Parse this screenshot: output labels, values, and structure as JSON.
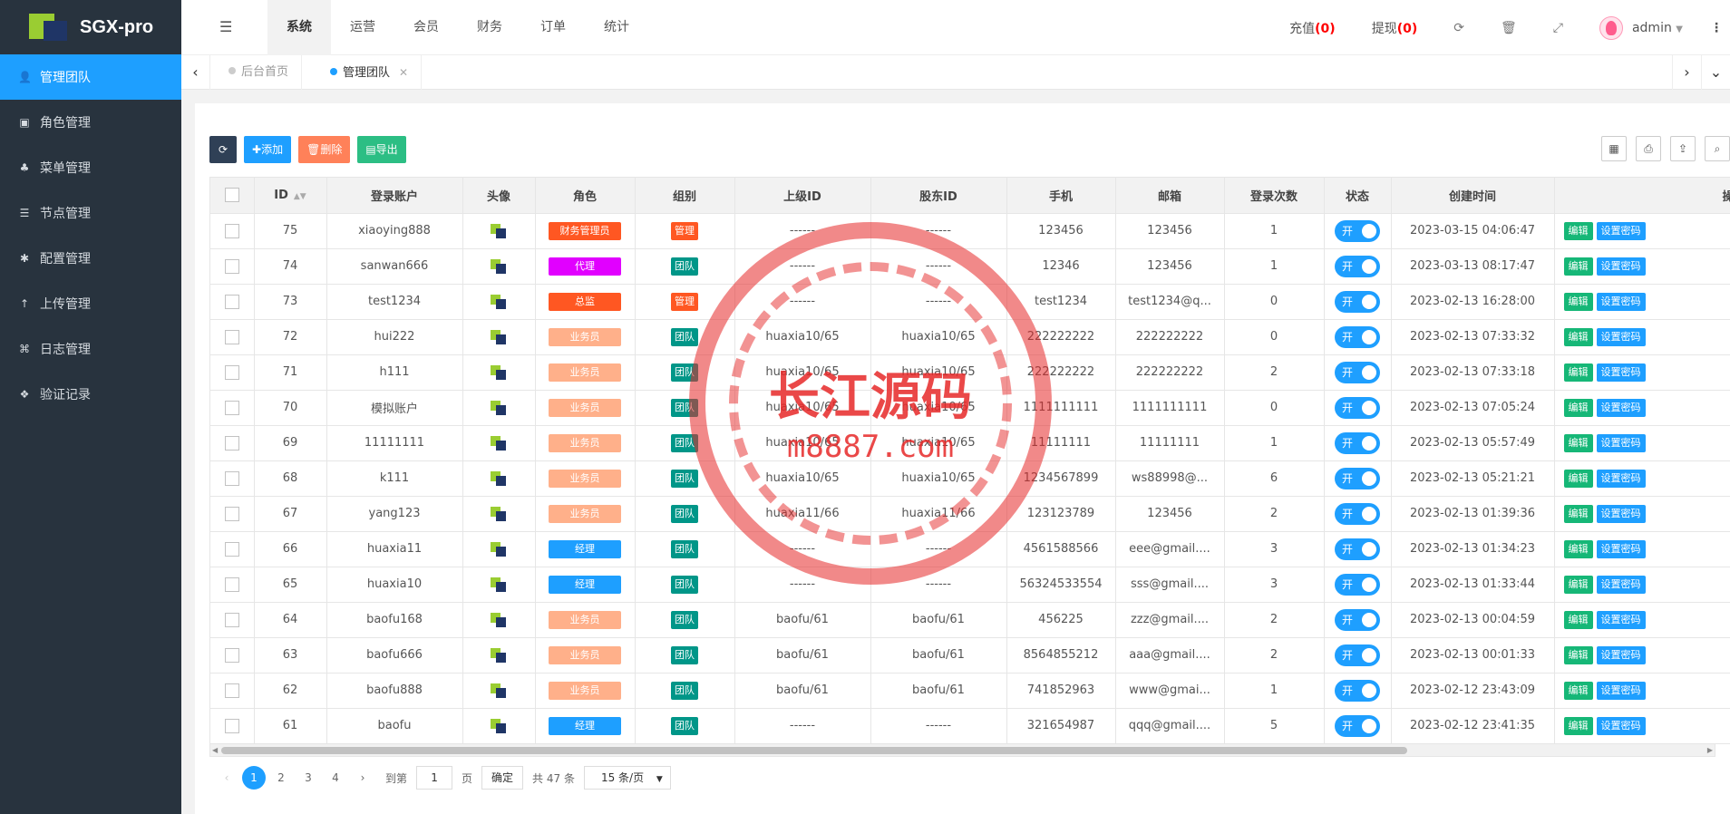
{
  "app": {
    "logo_text": "SGX-pro"
  },
  "sidebar": {
    "items": [
      {
        "label": "管理团队",
        "icon": "user-icon",
        "glyph": "👤",
        "active": true
      },
      {
        "label": "角色管理",
        "icon": "role-icon",
        "glyph": "▣"
      },
      {
        "label": "菜单管理",
        "icon": "tree-icon",
        "glyph": "♣"
      },
      {
        "label": "节点管理",
        "icon": "list-icon",
        "glyph": "☰"
      },
      {
        "label": "配置管理",
        "icon": "gear-icon",
        "glyph": "✱"
      },
      {
        "label": "上传管理",
        "icon": "upload-icon",
        "glyph": "↑"
      },
      {
        "label": "日志管理",
        "icon": "log-icon",
        "glyph": "⌘"
      },
      {
        "label": "验证记录",
        "icon": "verify-icon",
        "glyph": "❖"
      }
    ]
  },
  "topbar": {
    "nav": [
      "系统",
      "运营",
      "会员",
      "财务",
      "订单",
      "统计"
    ],
    "recharge_label": "充值",
    "recharge_count": "(0)",
    "withdraw_label": "提现",
    "withdraw_count": "(0)",
    "user_name": "admin"
  },
  "tabs": [
    {
      "label": "后台首页",
      "active": false
    },
    {
      "label": "管理团队",
      "active": true
    }
  ],
  "toolbar": {
    "add_label": "添加",
    "delete_label": "删除",
    "export_label": "导出"
  },
  "table": {
    "columns": [
      "ID",
      "登录账户",
      "头像",
      "角色",
      "组别",
      "上级ID",
      "股东ID",
      "手机",
      "邮箱",
      "登录次数",
      "状态",
      "创建时间",
      "操作"
    ],
    "switch_label": "开",
    "edit_label": "编辑",
    "reset_label": "设置密码",
    "rows": [
      {
        "id": "75",
        "account": "xiaoying888",
        "role": "财务管理员",
        "role_color": "#ff5722",
        "group": "管理",
        "group_color": "#ff5722",
        "parent": "------",
        "holder": "------",
        "phone": "123456",
        "email": "123456",
        "logins": "1",
        "created": "2023-03-15 04:06:47"
      },
      {
        "id": "74",
        "account": "sanwan666",
        "role": "代理",
        "role_color": "#e100ff",
        "group": "团队",
        "group_color": "#009688",
        "parent": "------",
        "holder": "------",
        "phone": "12346",
        "email": "123456",
        "logins": "1",
        "created": "2023-03-13 08:17:47"
      },
      {
        "id": "73",
        "account": "test1234",
        "role": "总监",
        "role_color": "#ff5722",
        "group": "管理",
        "group_color": "#ff5722",
        "parent": "------",
        "holder": "------",
        "phone": "test1234",
        "email": "test1234@q...",
        "logins": "0",
        "created": "2023-02-13 16:28:00"
      },
      {
        "id": "72",
        "account": "hui222",
        "role": "业务员",
        "role_color": "#ffb08a",
        "group": "团队",
        "group_color": "#009688",
        "parent": "huaxia10/65",
        "holder": "huaxia10/65",
        "phone": "222222222",
        "email": "222222222",
        "logins": "0",
        "created": "2023-02-13 07:33:32"
      },
      {
        "id": "71",
        "account": "h111",
        "role": "业务员",
        "role_color": "#ffb08a",
        "group": "团队",
        "group_color": "#009688",
        "parent": "huaxia10/65",
        "holder": "huaxia10/65",
        "phone": "222222222",
        "email": "222222222",
        "logins": "2",
        "created": "2023-02-13 07:33:18"
      },
      {
        "id": "70",
        "account": "模拟账户",
        "role": "业务员",
        "role_color": "#ffb08a",
        "group": "团队",
        "group_color": "#009688",
        "parent": "huaxia10/65",
        "holder": "huaxia10/65",
        "phone": "1111111111",
        "email": "1111111111",
        "logins": "0",
        "created": "2023-02-13 07:05:24"
      },
      {
        "id": "69",
        "account": "11111111",
        "role": "业务员",
        "role_color": "#ffb08a",
        "group": "团队",
        "group_color": "#009688",
        "parent": "huaxia10/65",
        "holder": "huaxia10/65",
        "phone": "11111111",
        "email": "11111111",
        "logins": "1",
        "created": "2023-02-13 05:57:49"
      },
      {
        "id": "68",
        "account": "k111",
        "role": "业务员",
        "role_color": "#ffb08a",
        "group": "团队",
        "group_color": "#009688",
        "parent": "huaxia10/65",
        "holder": "huaxia10/65",
        "phone": "1234567899",
        "email": "ws88998@...",
        "logins": "6",
        "created": "2023-02-13 05:21:21"
      },
      {
        "id": "67",
        "account": "yang123",
        "role": "业务员",
        "role_color": "#ffb08a",
        "group": "团队",
        "group_color": "#009688",
        "parent": "huaxia11/66",
        "holder": "huaxia11/66",
        "phone": "123123789",
        "email": "123456",
        "logins": "2",
        "created": "2023-02-13 01:39:36"
      },
      {
        "id": "66",
        "account": "huaxia11",
        "role": "经理",
        "role_color": "#1e9fff",
        "group": "团队",
        "group_color": "#009688",
        "parent": "------",
        "holder": "------",
        "phone": "4561588566",
        "email": "eee@gmail....",
        "logins": "3",
        "created": "2023-02-13 01:34:23"
      },
      {
        "id": "65",
        "account": "huaxia10",
        "role": "经理",
        "role_color": "#1e9fff",
        "group": "团队",
        "group_color": "#009688",
        "parent": "------",
        "holder": "------",
        "phone": "56324533554",
        "email": "sss@gmail....",
        "logins": "3",
        "created": "2023-02-13 01:33:44"
      },
      {
        "id": "64",
        "account": "baofu168",
        "role": "业务员",
        "role_color": "#ffb08a",
        "group": "团队",
        "group_color": "#009688",
        "parent": "baofu/61",
        "holder": "baofu/61",
        "phone": "456225",
        "email": "zzz@gmail....",
        "logins": "2",
        "created": "2023-02-13 00:04:59"
      },
      {
        "id": "63",
        "account": "baofu666",
        "role": "业务员",
        "role_color": "#ffb08a",
        "group": "团队",
        "group_color": "#009688",
        "parent": "baofu/61",
        "holder": "baofu/61",
        "phone": "8564855212",
        "email": "aaa@gmail....",
        "logins": "2",
        "created": "2023-02-13 00:01:33"
      },
      {
        "id": "62",
        "account": "baofu888",
        "role": "业务员",
        "role_color": "#ffb08a",
        "group": "团队",
        "group_color": "#009688",
        "parent": "baofu/61",
        "holder": "baofu/61",
        "phone": "741852963",
        "email": "www@gmai...",
        "logins": "1",
        "created": "2023-02-12 23:43:09"
      },
      {
        "id": "61",
        "account": "baofu",
        "role": "经理",
        "role_color": "#1e9fff",
        "group": "团队",
        "group_color": "#009688",
        "parent": "------",
        "holder": "------",
        "phone": "321654987",
        "email": "qqq@gmail....",
        "logins": "5",
        "created": "2023-02-12 23:41:35"
      }
    ]
  },
  "pager": {
    "pages": [
      "1",
      "2",
      "3",
      "4"
    ],
    "current": "1",
    "goto_label": "到第",
    "goto_value": "1",
    "page_unit": "页",
    "confirm_label": "确定",
    "total_label": "共 47 条",
    "page_size_label": "15 条/页"
  },
  "watermark": {
    "title": "长江源码",
    "url": "m8887.com"
  }
}
